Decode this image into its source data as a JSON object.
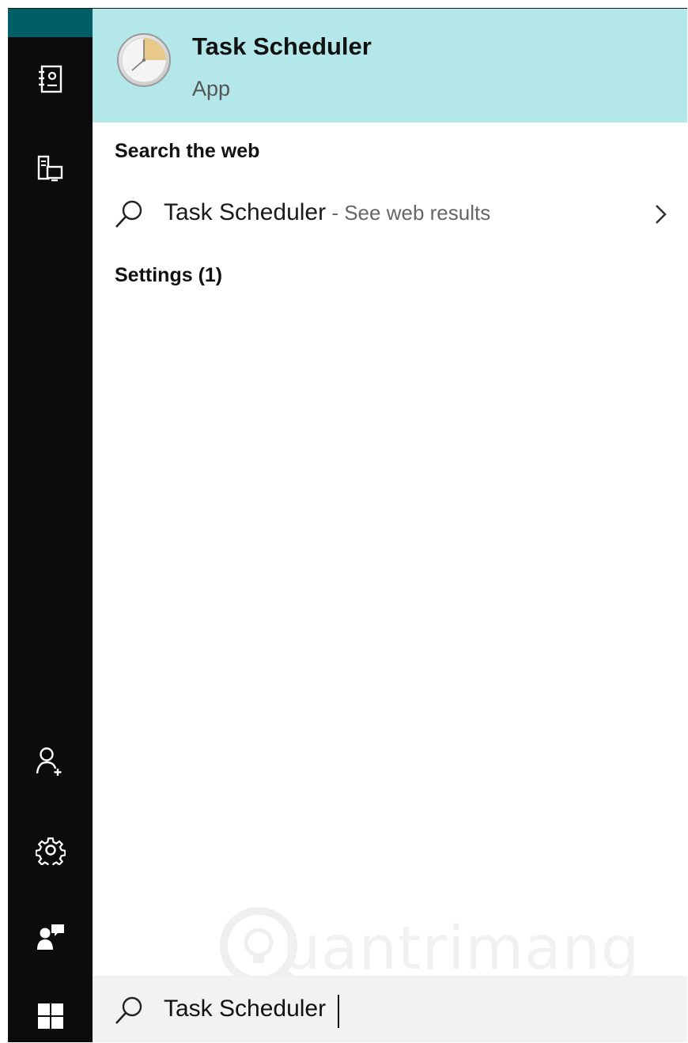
{
  "rail": {
    "icons": [
      "notebook-icon",
      "devices-icon",
      "add-user-icon",
      "settings-gear-icon",
      "feedback-icon",
      "windows-start-icon"
    ]
  },
  "best_match": {
    "title": "Task Scheduler",
    "subtitle": "App",
    "icon": "task-scheduler-clock-icon"
  },
  "web": {
    "section_title": "Search the web",
    "query": "Task Scheduler",
    "separator": " - ",
    "hint": "See web results"
  },
  "settings": {
    "section_title": "Settings (1)"
  },
  "watermark": {
    "text": "uantrimang"
  },
  "search": {
    "value": "Task Scheduler"
  },
  "colors": {
    "rail_bg": "#0c0c0c",
    "rail_accent": "#005f66",
    "highlight": "#b3e7ea",
    "search_box_bg": "#f2f2f2"
  }
}
